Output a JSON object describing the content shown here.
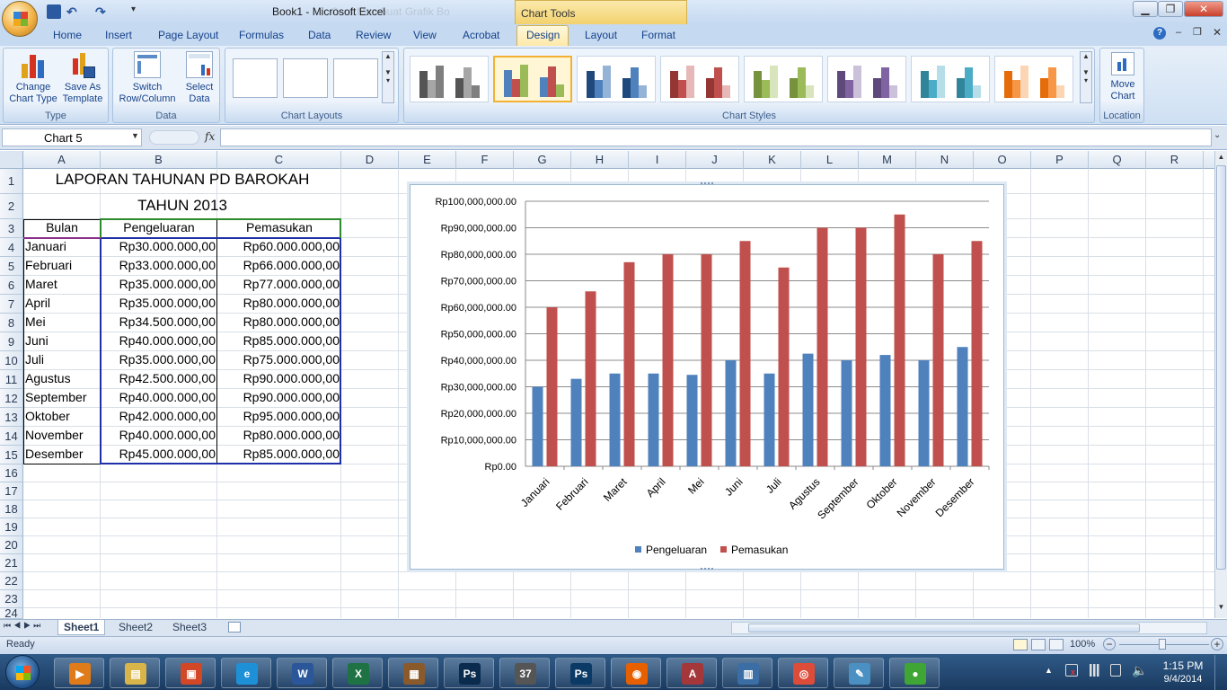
{
  "window": {
    "title": "Book1 - Microsoft Excel",
    "ghost_title": "Cara Membuat Grafik Bo",
    "context_tab": "Chart Tools"
  },
  "tabs": [
    "Home",
    "Insert",
    "Page Layout",
    "Formulas",
    "Data",
    "Review",
    "View",
    "Acrobat",
    "Design",
    "Layout",
    "Format"
  ],
  "active_tab": "Design",
  "ribbon": {
    "type_group": {
      "label": "Type",
      "change_chart_type": "Change Chart Type",
      "save_as_template": "Save As Template"
    },
    "data_group": {
      "label": "Data",
      "switch_row_column": "Switch Row/Column",
      "select_data": "Select Data"
    },
    "chart_layouts_label": "Chart Layouts",
    "chart_styles_label": "Chart Styles",
    "location_group": {
      "label": "Location",
      "move_chart": "Move Chart"
    },
    "style_colors": [
      [
        "#555555",
        "#a6a6a6",
        "#7f7f7f"
      ],
      [
        "#4f81bd",
        "#c0504d",
        "#9bbb59"
      ],
      [
        "#1f497d",
        "#4f81bd",
        "#95b3d7"
      ],
      [
        "#943634",
        "#c0504d",
        "#e6b9b8"
      ],
      [
        "#76923c",
        "#9bbb59",
        "#d7e4bc"
      ],
      [
        "#5f497a",
        "#8064a2",
        "#ccc1da"
      ],
      [
        "#31859b",
        "#4bacc6",
        "#b7dee8"
      ],
      [
        "#e46c0a",
        "#f79646",
        "#fcd5b4"
      ]
    ]
  },
  "formula_bar": {
    "name_box": "Chart 5",
    "fx": "fx",
    "value": ""
  },
  "columns": [
    "A",
    "B",
    "C",
    "D",
    "E",
    "F",
    "G",
    "H",
    "I",
    "J",
    "K",
    "L",
    "M",
    "N",
    "O",
    "P",
    "Q",
    "R"
  ],
  "rows": [
    "1",
    "2",
    "3",
    "4",
    "5",
    "6",
    "7",
    "8",
    "9",
    "10",
    "11",
    "12",
    "13",
    "14",
    "15",
    "16",
    "17",
    "18",
    "19",
    "20",
    "21",
    "22",
    "23",
    "24"
  ],
  "sheet": {
    "title1": "LAPORAN TAHUNAN PD BAROKAH",
    "title2": "TAHUN 2013",
    "headers": [
      "Bulan",
      "Pengeluaran",
      "Pemasukan"
    ],
    "data": [
      [
        "Januari",
        "Rp30.000.000,00",
        "Rp60.000.000,00"
      ],
      [
        "Februari",
        "Rp33.000.000,00",
        "Rp66.000.000,00"
      ],
      [
        "Maret",
        "Rp35.000.000,00",
        "Rp77.000.000,00"
      ],
      [
        "April",
        "Rp35.000.000,00",
        "Rp80.000.000,00"
      ],
      [
        "Mei",
        "Rp34.500.000,00",
        "Rp80.000.000,00"
      ],
      [
        "Juni",
        "Rp40.000.000,00",
        "Rp85.000.000,00"
      ],
      [
        "Juli",
        "Rp35.000.000,00",
        "Rp75.000.000,00"
      ],
      [
        "Agustus",
        "Rp42.500.000,00",
        "Rp90.000.000,00"
      ],
      [
        "September",
        "Rp40.000.000,00",
        "Rp90.000.000,00"
      ],
      [
        "Oktober",
        "Rp42.000.000,00",
        "Rp95.000.000,00"
      ],
      [
        "November",
        "Rp40.000.000,00",
        "Rp80.000.000,00"
      ],
      [
        "Desember",
        "Rp45.000.000,00",
        "Rp85.000.000,00"
      ]
    ]
  },
  "chart_data": {
    "type": "bar",
    "categories": [
      "Januari",
      "Februari",
      "Maret",
      "April",
      "Mei",
      "Juni",
      "Juli",
      "Agustus",
      "September",
      "Oktober",
      "November",
      "Desember"
    ],
    "series": [
      {
        "name": "Pengeluaran",
        "color": "#4f81bd",
        "values": [
          30000000,
          33000000,
          35000000,
          35000000,
          34500000,
          40000000,
          35000000,
          42500000,
          40000000,
          42000000,
          40000000,
          45000000
        ]
      },
      {
        "name": "Pemasukan",
        "color": "#c0504d",
        "values": [
          60000000,
          66000000,
          77000000,
          80000000,
          80000000,
          85000000,
          75000000,
          90000000,
          90000000,
          95000000,
          80000000,
          85000000
        ]
      }
    ],
    "ylim": [
      0,
      100000000
    ],
    "yticks": [
      "Rp0.00",
      "Rp10,000,000.00",
      "Rp20,000,000.00",
      "Rp30,000,000.00",
      "Rp40,000,000.00",
      "Rp50,000,000.00",
      "Rp60,000,000.00",
      "Rp70,000,000.00",
      "Rp80,000,000.00",
      "Rp90,000,000.00",
      "Rp100,000,000.00"
    ],
    "grid": true,
    "legend": "bottom"
  },
  "sheet_tabs": [
    "Sheet1",
    "Sheet2",
    "Sheet3"
  ],
  "active_sheet": "Sheet1",
  "status": {
    "ready": "Ready",
    "zoom": "100%"
  },
  "taskbar": {
    "apps": [
      {
        "name": "media-player-icon",
        "glyph": "▶",
        "color": "#e07b1a"
      },
      {
        "name": "file-explorer-icon",
        "glyph": "▤",
        "color": "#d9b44a"
      },
      {
        "name": "presentation-app-icon",
        "glyph": "▣",
        "color": "#d24726"
      },
      {
        "name": "internet-explorer-icon",
        "glyph": "e",
        "color": "#1e90d8"
      },
      {
        "name": "word-icon",
        "glyph": "W",
        "color": "#2b579a"
      },
      {
        "name": "excel-icon",
        "glyph": "X",
        "color": "#1f7244"
      },
      {
        "name": "winrar-icon",
        "glyph": "▦",
        "color": "#8b5a2b"
      },
      {
        "name": "photoshop-icon",
        "glyph": "Ps",
        "color": "#0a2b4d"
      },
      {
        "name": "video-editor-icon",
        "glyph": "37",
        "color": "#555555"
      },
      {
        "name": "photoshop-2-icon",
        "glyph": "Ps",
        "color": "#0b3a66"
      },
      {
        "name": "firefox-icon",
        "glyph": "◉",
        "color": "#e66000"
      },
      {
        "name": "access-icon",
        "glyph": "A",
        "color": "#a4373a"
      },
      {
        "name": "network-app-icon",
        "glyph": "▥",
        "color": "#3a6ea5"
      },
      {
        "name": "chrome-icon",
        "glyph": "◎",
        "color": "#dd4b39"
      },
      {
        "name": "paint-icon",
        "glyph": "✎",
        "color": "#4a90c2"
      },
      {
        "name": "camtasia-icon",
        "glyph": "●",
        "color": "#3fa535"
      }
    ],
    "time": "1:15 PM",
    "date": "9/4/2014"
  }
}
